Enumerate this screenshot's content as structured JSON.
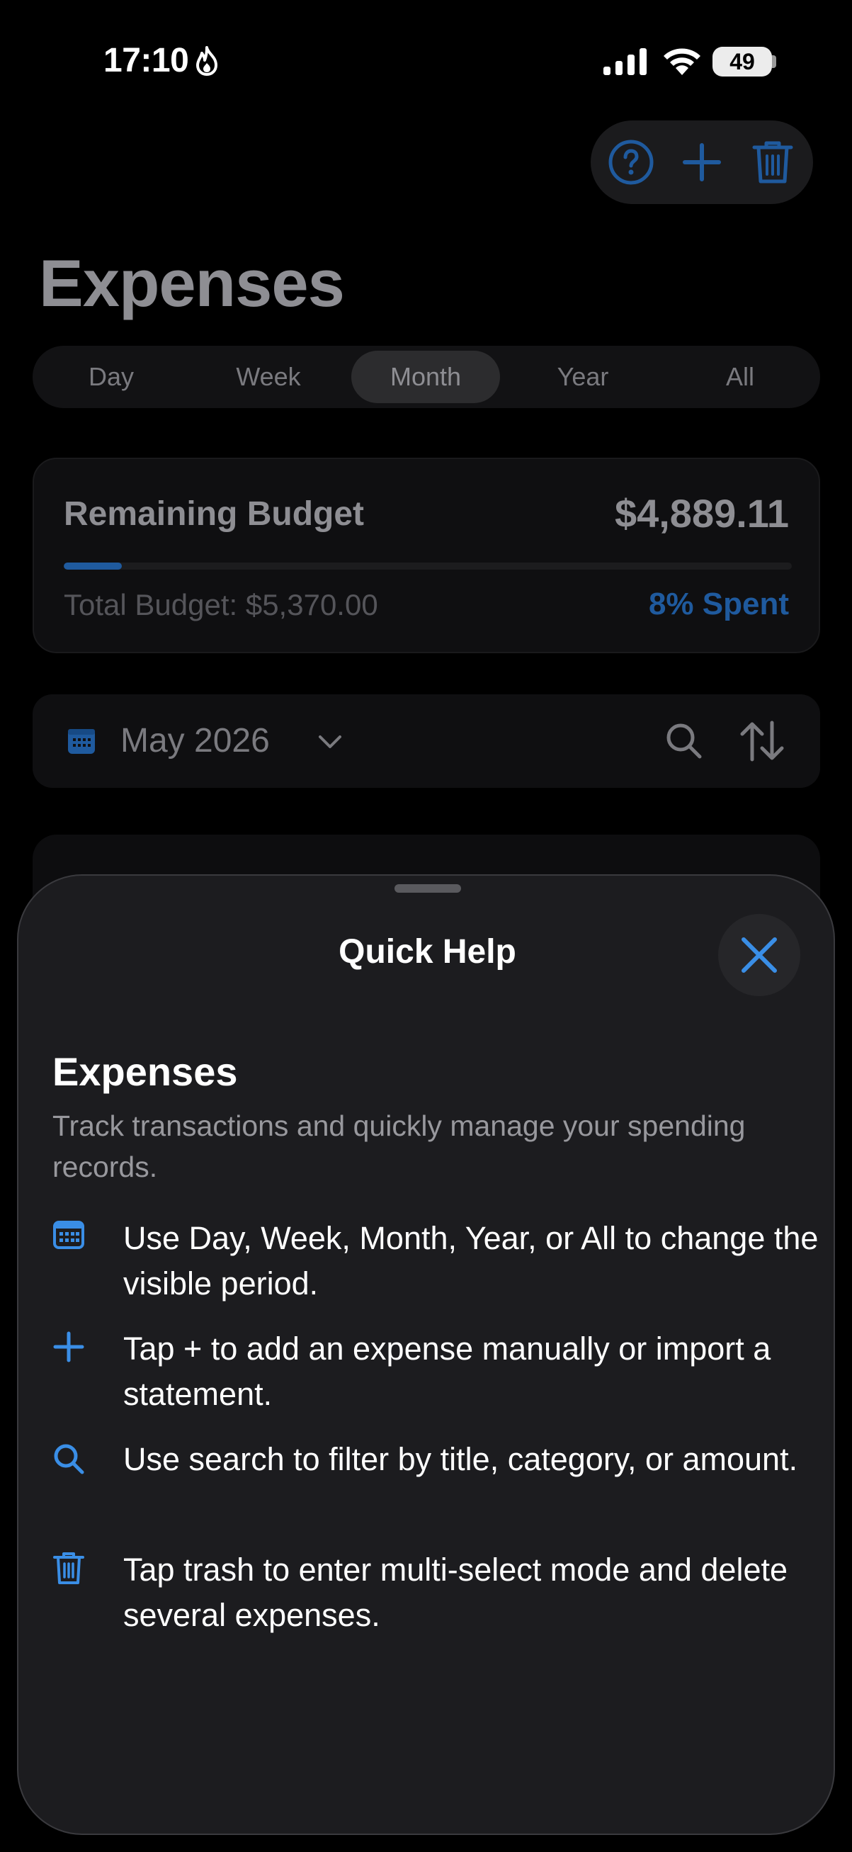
{
  "status": {
    "time": "17:10",
    "battery": "49"
  },
  "header": {
    "title": "Expenses"
  },
  "periods": [
    {
      "label": "Day"
    },
    {
      "label": "Week"
    },
    {
      "label": "Month"
    },
    {
      "label": "Year"
    },
    {
      "label": "All"
    }
  ],
  "selected_period": "Month",
  "budget": {
    "label": "Remaining Budget",
    "amount": "$4,889.11",
    "total": "Total Budget: $5,370.00",
    "spent": "8% Spent",
    "spent_fraction": 0.08
  },
  "date_filter": {
    "label": "May 2026"
  },
  "sheet": {
    "title": "Quick Help",
    "heading": "Expenses",
    "description": "Track transactions and quickly manage your spending records.",
    "tips": [
      {
        "icon": "calendar-icon",
        "text": "Use Day, Week, Month, Year, or All to change the visible period."
      },
      {
        "icon": "plus-icon",
        "text": "Tap + to add an expense manually or import a statement."
      },
      {
        "icon": "search-icon",
        "text": "Use search to filter by title, category, or amount."
      },
      {
        "icon": "trash-icon",
        "text": "Tap trash to enter multi-select mode and delete several expenses."
      }
    ]
  },
  "colors": {
    "accent": "#3a8ee6",
    "accent_dim": "#1f5a9e",
    "sheet_bg": "#1c1c1f"
  }
}
